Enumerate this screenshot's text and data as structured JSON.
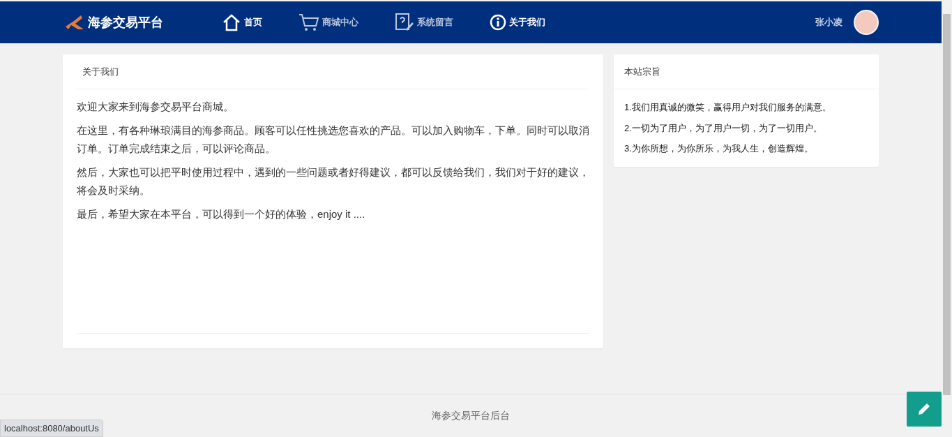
{
  "brand": {
    "title": "海参交易平台"
  },
  "nav": [
    {
      "label": "首页",
      "selected": true
    },
    {
      "label": "商城中心",
      "selected": false
    },
    {
      "label": "系统留言",
      "selected": false
    },
    {
      "label": "关于我们",
      "selected": true
    }
  ],
  "user": {
    "name": "张小凌"
  },
  "about": {
    "title": "关于我们",
    "paragraphs": [
      "欢迎大家来到海参交易平台商城。",
      "在这里，有各种琳琅满目的海参商品。顾客可以任性挑选您喜欢的产品。可以加入购物车，下单。同时可以取消订单。订单完成结束之后，可以评论商品。",
      "然后，大家也可以把平时使用过程中，遇到的一些问题或者好得建议，都可以反馈给我们，我们对于好的建议，将会及时采纳。",
      "最后，希望大家在本平台，可以得到一个好的体验，enjoy it ...."
    ]
  },
  "mission": {
    "title": "本站宗旨",
    "items": [
      "1.我们用真诚的微笑，赢得用户对我们服务的满意。",
      "2.一切为了用户，为了用户一切，为了一切用户。",
      "3.为你所想，为你所乐，为我人生，创造辉煌。"
    ]
  },
  "footer": {
    "text": "海参交易平台后台"
  },
  "status_url": "localhost:8080/aboutUs"
}
